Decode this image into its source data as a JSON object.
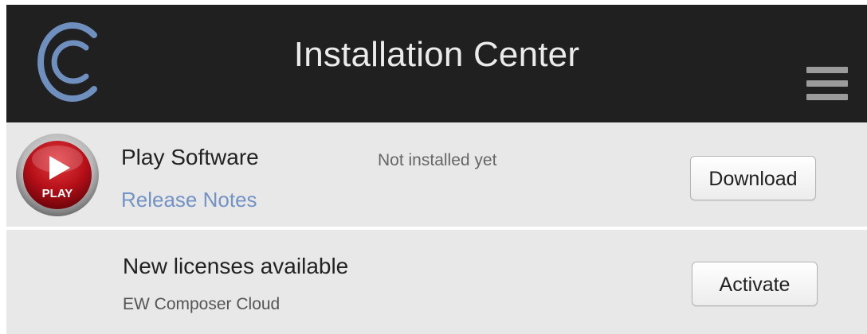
{
  "header": {
    "title": "Installation Center",
    "logo_icon": "composer-cloud-logo",
    "menu_icon": "hamburger-menu-icon",
    "colors": {
      "background": "#202020",
      "title": "#ebebeb",
      "logo": "#6f8fbe",
      "menu": "#9b9b9b"
    }
  },
  "products": [
    {
      "icon": "play-icon",
      "icon_label": "PLAY",
      "name": "Play Software",
      "status": "Not installed yet",
      "link_label": "Release Notes",
      "action_label": "Download"
    }
  ],
  "licenses": {
    "title": "New licenses available",
    "subtitle": "EW Composer Cloud",
    "action_label": "Activate"
  },
  "colors": {
    "row_background": "#e8e8e8",
    "link": "#7393c4",
    "play_red": "#c1121c"
  }
}
